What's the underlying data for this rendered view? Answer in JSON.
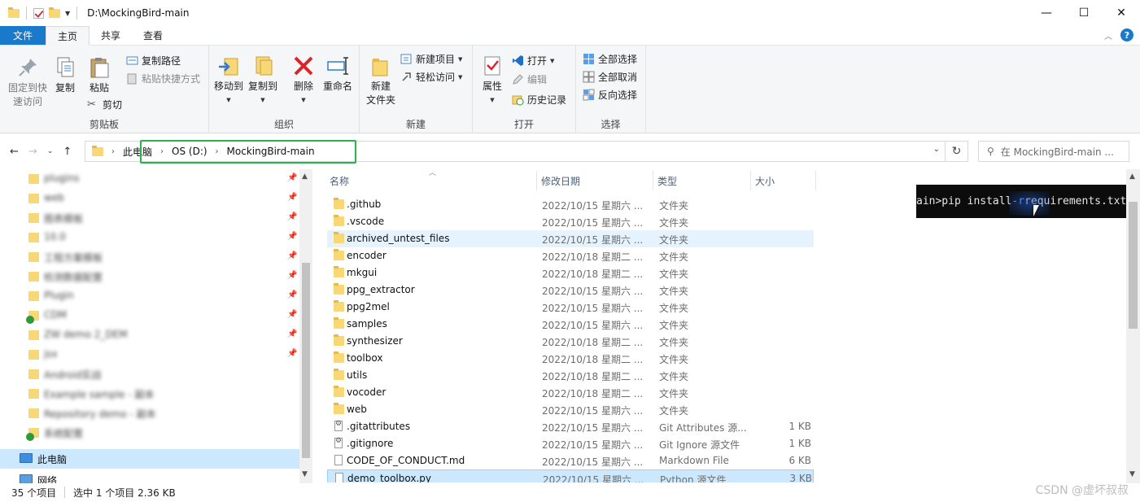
{
  "window": {
    "title": "D:\\MockingBird-main",
    "controls": [
      "—",
      "☐",
      "✕"
    ]
  },
  "tabs": {
    "file": "文件",
    "home": "主页",
    "share": "共享",
    "view": "查看",
    "help": "?"
  },
  "ribbon": {
    "clipboard": {
      "label": "剪贴板",
      "pin": "固定到快\n速访问",
      "copy": "复制",
      "paste": "粘贴",
      "copy_path": "复制路径",
      "paste_shortcut": "粘贴快捷方式",
      "cut": "剪切"
    },
    "organize": {
      "label": "组织",
      "move_to": "移动到",
      "copy_to": "复制到",
      "delete": "删除",
      "rename": "重命名"
    },
    "new": {
      "label": "新建",
      "new_folder": "新建\n文件夹",
      "new_item": "新建项目",
      "easy_access": "轻松访问"
    },
    "open": {
      "label": "打开",
      "properties": "属性",
      "open": "打开",
      "edit": "编辑",
      "history": "历史记录"
    },
    "select": {
      "label": "选择",
      "select_all": "全部选择",
      "select_none": "全部取消",
      "invert": "反向选择"
    }
  },
  "address": {
    "crumbs": [
      "此电脑",
      "OS (D:)",
      "MockingBird-main"
    ],
    "search_placeholder": "在 MockingBird-main ..."
  },
  "nav": {
    "items": [
      {
        "label": "plugins"
      },
      {
        "label": "web"
      },
      {
        "label": "图表模板"
      },
      {
        "label": "10.0"
      },
      {
        "label": "工程方案模板"
      },
      {
        "label": "检测数据配置"
      },
      {
        "label": "Plugin"
      },
      {
        "label": "CDM"
      },
      {
        "label": "ZW demo 2_DEM"
      },
      {
        "label": "jsx"
      },
      {
        "label": "Android实战"
      },
      {
        "label": "Example sample - 副本"
      },
      {
        "label": "Repository demo - 副本"
      },
      {
        "label": "系统配置"
      }
    ],
    "this_pc": "此电脑",
    "network": "网络"
  },
  "columns": {
    "name": "名称",
    "date": "修改日期",
    "type": "类型",
    "size": "大小"
  },
  "files": [
    {
      "name": ".github",
      "date": "2022/10/15 星期六 ...",
      "type": "文件夹",
      "size": "",
      "kind": "folder"
    },
    {
      "name": ".vscode",
      "date": "2022/10/15 星期六 ...",
      "type": "文件夹",
      "size": "",
      "kind": "folder"
    },
    {
      "name": "archived_untest_files",
      "date": "2022/10/15 星期六 ...",
      "type": "文件夹",
      "size": "",
      "kind": "folder"
    },
    {
      "name": "encoder",
      "date": "2022/10/18 星期二 ...",
      "type": "文件夹",
      "size": "",
      "kind": "folder"
    },
    {
      "name": "mkgui",
      "date": "2022/10/18 星期二 ...",
      "type": "文件夹",
      "size": "",
      "kind": "folder"
    },
    {
      "name": "ppg_extractor",
      "date": "2022/10/15 星期六 ...",
      "type": "文件夹",
      "size": "",
      "kind": "folder"
    },
    {
      "name": "ppg2mel",
      "date": "2022/10/15 星期六 ...",
      "type": "文件夹",
      "size": "",
      "kind": "folder"
    },
    {
      "name": "samples",
      "date": "2022/10/15 星期六 ...",
      "type": "文件夹",
      "size": "",
      "kind": "folder"
    },
    {
      "name": "synthesizer",
      "date": "2022/10/18 星期二 ...",
      "type": "文件夹",
      "size": "",
      "kind": "folder"
    },
    {
      "name": "toolbox",
      "date": "2022/10/18 星期二 ...",
      "type": "文件夹",
      "size": "",
      "kind": "folder"
    },
    {
      "name": "utils",
      "date": "2022/10/18 星期二 ...",
      "type": "文件夹",
      "size": "",
      "kind": "folder"
    },
    {
      "name": "vocoder",
      "date": "2022/10/18 星期二 ...",
      "type": "文件夹",
      "size": "",
      "kind": "folder"
    },
    {
      "name": "web",
      "date": "2022/10/15 星期六 ...",
      "type": "文件夹",
      "size": "",
      "kind": "folder"
    },
    {
      "name": ".gitattributes",
      "date": "2022/10/15 星期六 ...",
      "type": "Git Attributes 源...",
      "size": "1 KB",
      "kind": "gear"
    },
    {
      "name": ".gitignore",
      "date": "2022/10/15 星期六 ...",
      "type": "Git Ignore 源文件",
      "size": "1 KB",
      "kind": "gear"
    },
    {
      "name": "CODE_OF_CONDUCT.md",
      "date": "2022/10/15 星期六 ...",
      "type": "Markdown File",
      "size": "6 KB",
      "kind": "doc"
    },
    {
      "name": "demo_toolbox.py",
      "date": "2022/10/15 星期六 ...",
      "type": "Python 源文件",
      "size": "3 KB",
      "kind": "doc"
    }
  ],
  "terminal": {
    "prefix": "ain>pip install ",
    "flag": "-r",
    "suffix": " requirements.txt"
  },
  "status": {
    "count": "35 个项目",
    "selection": "选中 1 个项目  2.36 KB"
  },
  "watermark": "CSDN @虚坏叔叔",
  "colors": {
    "accent": "#1979ca",
    "highlight_box": "#2bb24c",
    "folder": "#f8d775",
    "selection": "#cce8ff"
  }
}
